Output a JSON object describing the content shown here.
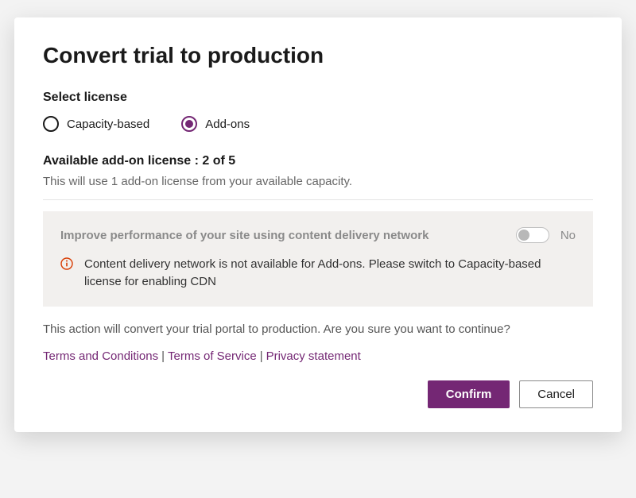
{
  "modal": {
    "title": "Convert trial to production",
    "select_license_label": "Select license",
    "radio": {
      "capacity": "Capacity-based",
      "addons": "Add-ons"
    },
    "available_line": "Available add-on license : 2 of 5",
    "usage_line": "This will use 1 add-on license from your available capacity.",
    "cdn_toggle_label": "Improve performance of your site using content delivery network",
    "cdn_toggle_state": "No",
    "cdn_warning": "Content delivery network is not available for Add-ons. Please switch to Capacity-based license for enabling CDN",
    "confirm_text": "This action will convert your trial portal to production. Are you sure you want to continue?",
    "links": {
      "terms_conditions": "Terms and Conditions",
      "terms_service": "Terms of Service",
      "privacy": "Privacy statement"
    },
    "buttons": {
      "confirm": "Confirm",
      "cancel": "Cancel"
    }
  }
}
